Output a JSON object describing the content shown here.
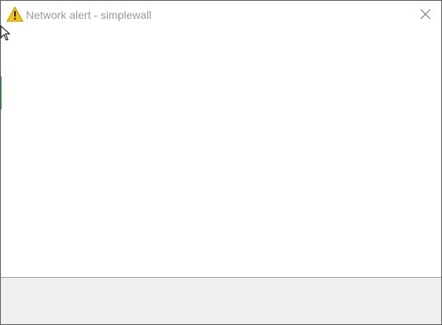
{
  "window": {
    "title": "Network alert - simplewall",
    "title_icon": "warning-icon",
    "close_icon": "close-icon"
  },
  "colors": {
    "warning_fill": "#f6c700",
    "title_text": "#9a9a9a",
    "footer_bg": "#f0f0f0",
    "border": "#5a5a5a"
  }
}
